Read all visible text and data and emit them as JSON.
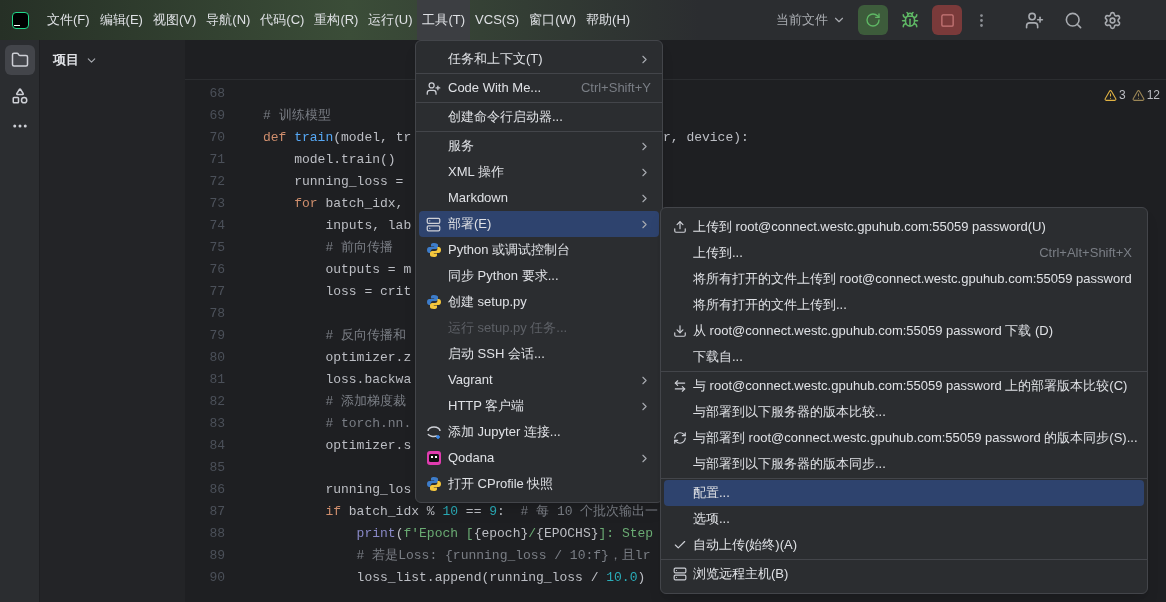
{
  "main_menu": [
    {
      "label": "文件(F)",
      "selected": false
    },
    {
      "label": "编辑(E)",
      "selected": false
    },
    {
      "label": "视图(V)",
      "selected": false
    },
    {
      "label": "导航(N)",
      "selected": false
    },
    {
      "label": "代码(C)",
      "selected": false
    },
    {
      "label": "重构(R)",
      "selected": false
    },
    {
      "label": "运行(U)",
      "selected": false
    },
    {
      "label": "工具(T)",
      "selected": true
    },
    {
      "label": "VCS(S)",
      "selected": false
    },
    {
      "label": "窗口(W)",
      "selected": false
    },
    {
      "label": "帮助(H)",
      "selected": false
    }
  ],
  "run_config": "当前文件",
  "project_panel": {
    "title": "项目"
  },
  "inspections": [
    {
      "count": "3",
      "color": "#e0b243"
    },
    {
      "count": "12",
      "color": "#9b8656"
    }
  ],
  "code_lines": [
    {
      "number": "68"
    },
    {
      "number": "69",
      "tokens": [
        {
          "text": "# 训练模型",
          "kind": "comment"
        }
      ]
    },
    {
      "number": "70",
      "tokens": [
        {
          "text": "def",
          "kind": "keyword"
        },
        {
          "text": " train",
          "kind": "function"
        },
        {
          "text": "(model, tr",
          "kind": "plain"
        }
      ],
      "tail": "r, device):"
    },
    {
      "number": "71",
      "tokens": [
        {
          "text": "    model.train()",
          "kind": "plain"
        }
      ]
    },
    {
      "number": "72",
      "tokens": [
        {
          "text": "    running_loss = ",
          "kind": "plain"
        }
      ]
    },
    {
      "number": "73",
      "tokens": [
        {
          "text": "    for",
          "kind": "keyword"
        },
        {
          "text": " batch_idx,",
          "kind": "plain"
        }
      ]
    },
    {
      "number": "74",
      "tokens": [
        {
          "text": "        inputs, lab",
          "kind": "plain"
        }
      ]
    },
    {
      "number": "75",
      "tokens": [
        {
          "text": "        # 前向传播",
          "kind": "comment"
        }
      ]
    },
    {
      "number": "76",
      "tokens": [
        {
          "text": "        outputs = m",
          "kind": "plain"
        }
      ]
    },
    {
      "number": "77",
      "tokens": [
        {
          "text": "        loss = crit",
          "kind": "plain"
        }
      ]
    },
    {
      "number": "78"
    },
    {
      "number": "79",
      "tokens": [
        {
          "text": "        # 反向传播和",
          "kind": "comment"
        }
      ]
    },
    {
      "number": "80",
      "tokens": [
        {
          "text": "        optimizer.z",
          "kind": "plain"
        }
      ]
    },
    {
      "number": "81",
      "tokens": [
        {
          "text": "        loss.backwa",
          "kind": "plain"
        }
      ]
    },
    {
      "number": "82",
      "tokens": [
        {
          "text": "        # 添加梯度裁",
          "kind": "comment"
        }
      ]
    },
    {
      "number": "83",
      "tokens": [
        {
          "text": "        # torch.nn.",
          "kind": "comment"
        }
      ]
    },
    {
      "number": "84",
      "tokens": [
        {
          "text": "        optimizer.s",
          "kind": "plain"
        }
      ]
    },
    {
      "number": "85"
    },
    {
      "number": "86",
      "tokens": [
        {
          "text": "        running_los",
          "kind": "plain"
        }
      ]
    },
    {
      "number": "87",
      "tokens": [
        {
          "text": "        if",
          "kind": "keyword"
        },
        {
          "text": " batch_idx % ",
          "kind": "plain"
        },
        {
          "text": "10",
          "kind": "number"
        },
        {
          "text": " == ",
          "kind": "plain"
        },
        {
          "text": "9",
          "kind": "number"
        },
        {
          "text": ":  ",
          "kind": "plain"
        },
        {
          "text": "# 每 10 个批次输出一",
          "kind": "comment"
        }
      ]
    },
    {
      "number": "88",
      "tokens": [
        {
          "text": "            print",
          "kind": "builtin"
        },
        {
          "text": "(",
          "kind": "plain"
        },
        {
          "text": "f'Epoch [",
          "kind": "string"
        },
        {
          "text": "{epoch}",
          "kind": "plain"
        },
        {
          "text": "/",
          "kind": "string"
        },
        {
          "text": "{EPOCHS}",
          "kind": "plain"
        },
        {
          "text": "]: Step",
          "kind": "string"
        }
      ]
    },
    {
      "number": "89",
      "tokens": [
        {
          "text": "            # 若是Loss: {running_loss / 10:f}，且lr",
          "kind": "comment"
        }
      ]
    },
    {
      "number": "90",
      "tokens": [
        {
          "text": "            loss_list.append(running_loss / ",
          "kind": "plain"
        },
        {
          "text": "10.0",
          "kind": "number"
        },
        {
          "text": ")",
          "kind": "plain"
        }
      ]
    }
  ],
  "tools_menu": [
    {
      "kind": "item",
      "label": "任务和上下文(T)",
      "submenu": true,
      "selected": false,
      "disabled": false
    },
    {
      "kind": "separator"
    },
    {
      "kind": "item",
      "label": "Code With Me...",
      "shortcut": "Ctrl+Shift+Y",
      "submenu": false,
      "selected": false,
      "disabled": false
    },
    {
      "kind": "separator"
    },
    {
      "kind": "item",
      "label": "创建命令行启动器...",
      "submenu": false,
      "selected": false,
      "disabled": false
    },
    {
      "kind": "separator"
    },
    {
      "kind": "item",
      "label": "服务",
      "submenu": true,
      "selected": false,
      "disabled": false
    },
    {
      "kind": "item",
      "label": "XML 操作",
      "submenu": true,
      "selected": false,
      "disabled": false
    },
    {
      "kind": "item",
      "label": "Markdown",
      "submenu": true,
      "selected": false,
      "disabled": false
    },
    {
      "kind": "item",
      "label": "部署(E)",
      "submenu": true,
      "selected": true,
      "disabled": false
    },
    {
      "kind": "item",
      "label": "Python 或调试控制台",
      "submenu": false,
      "selected": false,
      "disabled": false
    },
    {
      "kind": "item",
      "label": "同步 Python 要求...",
      "submenu": false,
      "selected": false,
      "disabled": false
    },
    {
      "kind": "item",
      "label": "创建 setup.py",
      "submenu": false,
      "selected": false,
      "disabled": false
    },
    {
      "kind": "item",
      "label": "运行 setup.py 任务...",
      "submenu": false,
      "selected": false,
      "disabled": true
    },
    {
      "kind": "item",
      "label": "启动 SSH 会话...",
      "submenu": false,
      "selected": false,
      "disabled": false
    },
    {
      "kind": "item",
      "label": "Vagrant",
      "submenu": true,
      "selected": false,
      "disabled": false
    },
    {
      "kind": "item",
      "label": "HTTP 客户端",
      "submenu": true,
      "selected": false,
      "disabled": false
    },
    {
      "kind": "item",
      "label": "添加 Jupyter 连接...",
      "submenu": false,
      "selected": false,
      "disabled": false
    },
    {
      "kind": "item",
      "label": "Qodana",
      "submenu": true,
      "selected": false,
      "disabled": false
    },
    {
      "kind": "item",
      "label": "打开 CProfile 快照",
      "submenu": false,
      "selected": false,
      "disabled": false
    }
  ],
  "deploy_menu": [
    {
      "kind": "item",
      "label": "上传到 root@connect.westc.gpuhub.com:55059 password(U)",
      "selected": false,
      "checked": false
    },
    {
      "kind": "item",
      "label": "上传到...",
      "shortcut": "Ctrl+Alt+Shift+X",
      "selected": false,
      "checked": false
    },
    {
      "kind": "item",
      "label": "将所有打开的文件上传到 root@connect.westc.gpuhub.com:55059 password",
      "selected": false,
      "checked": false
    },
    {
      "kind": "item",
      "label": "将所有打开的文件上传到...",
      "selected": false,
      "checked": false
    },
    {
      "kind": "item",
      "label": "从 root@connect.westc.gpuhub.com:55059 password 下载 (D)",
      "selected": false,
      "checked": false
    },
    {
      "kind": "item",
      "label": "下载自...",
      "selected": false,
      "checked": false
    },
    {
      "kind": "separator"
    },
    {
      "kind": "item",
      "label": "与 root@connect.westc.gpuhub.com:55059 password 上的部署版本比较(C)",
      "selected": false,
      "checked": false
    },
    {
      "kind": "item",
      "label": "与部署到以下服务器的版本比较...",
      "selected": false,
      "checked": false
    },
    {
      "kind": "item",
      "label": "与部署到 root@connect.westc.gpuhub.com:55059 password 的版本同步(S)...",
      "selected": false,
      "checked": false
    },
    {
      "kind": "item",
      "label": "与部署到以下服务器的版本同步...",
      "selected": false,
      "checked": false
    },
    {
      "kind": "separator"
    },
    {
      "kind": "item",
      "label": "配置...",
      "selected": true,
      "checked": false
    },
    {
      "kind": "item",
      "label": "选项...",
      "selected": false,
      "checked": false
    },
    {
      "kind": "item",
      "label": "自动上传(始终)(A)",
      "selected": false,
      "checked": true
    },
    {
      "kind": "separator"
    },
    {
      "kind": "item",
      "label": "浏览远程主机(B)",
      "selected": false,
      "checked": false
    }
  ]
}
